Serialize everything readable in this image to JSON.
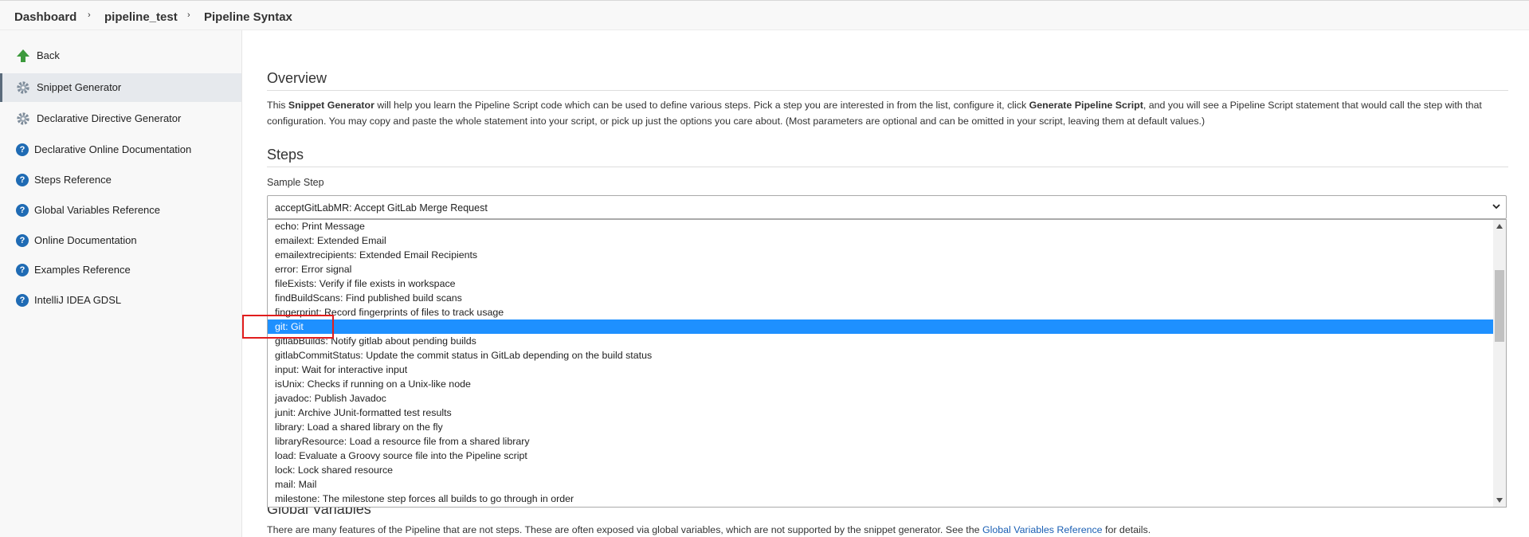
{
  "breadcrumb": {
    "items": [
      "Dashboard",
      "pipeline_test",
      "Pipeline Syntax"
    ]
  },
  "sidebar": {
    "items": [
      {
        "label": "Back",
        "icon": "back-arrow-icon"
      },
      {
        "label": "Snippet Generator",
        "icon": "gear-icon",
        "active": true
      },
      {
        "label": "Declarative Directive Generator",
        "icon": "gear-icon"
      },
      {
        "label": "Declarative Online Documentation",
        "icon": "help-icon"
      },
      {
        "label": "Steps Reference",
        "icon": "help-icon"
      },
      {
        "label": "Global Variables Reference",
        "icon": "help-icon"
      },
      {
        "label": "Online Documentation",
        "icon": "help-icon"
      },
      {
        "label": "Examples Reference",
        "icon": "help-icon"
      },
      {
        "label": "IntelliJ IDEA GDSL",
        "icon": "help-icon"
      }
    ]
  },
  "overview": {
    "title": "Overview",
    "p_intro": "This ",
    "p_bold1": "Snippet Generator",
    "p_mid": " will help you learn the Pipeline Script code which can be used to define various steps. Pick a step you are interested in from the list, configure it, click ",
    "p_bold2": "Generate Pipeline Script",
    "p_end": ", and you will see a Pipeline Script statement that would call the step with that",
    "p_line2": "configuration. You may copy and paste the whole statement into your script, or pick up just the options you care about. (Most parameters are optional and can be omitted in your script, leaving them at default values.)"
  },
  "steps": {
    "title": "Steps",
    "sample_label": "Sample Step",
    "selected_value": "acceptGitLabMR: Accept GitLab Merge Request",
    "options": [
      "echo: Print Message",
      "emailext: Extended Email",
      "emailextrecipients: Extended Email Recipients",
      "error: Error signal",
      "fileExists: Verify if file exists in workspace",
      "findBuildScans: Find published build scans",
      "fingerprint: Record fingerprints of files to track usage",
      "git: Git",
      "gitlabBuilds: Notify gitlab about pending builds",
      "gitlabCommitStatus: Update the commit status in GitLab depending on the build status",
      "input: Wait for interactive input",
      "isUnix: Checks if running on a Unix-like node",
      "javadoc: Publish Javadoc",
      "junit: Archive JUnit-formatted test results",
      "library: Load a shared library on the fly",
      "libraryResource: Load a resource file from a shared library",
      "load: Evaluate a Groovy source file into the Pipeline script",
      "lock: Lock shared resource",
      "mail: Mail",
      "milestone: The milestone step forces all builds to go through in order"
    ],
    "highlighted_index": 7
  },
  "global_variables": {
    "title_partial": "Global Variables",
    "text": "There are many features of the Pipeline that are not steps. These are often exposed via global variables, which are not supported by the snippet generator. See the ",
    "link": "Global Variables Reference",
    "text_end": " for details."
  },
  "colors": {
    "selection": "#1e90ff",
    "annotation_box": "#e11d1d",
    "help_icon": "#1f6bb4",
    "link": "#1a5fb4"
  }
}
